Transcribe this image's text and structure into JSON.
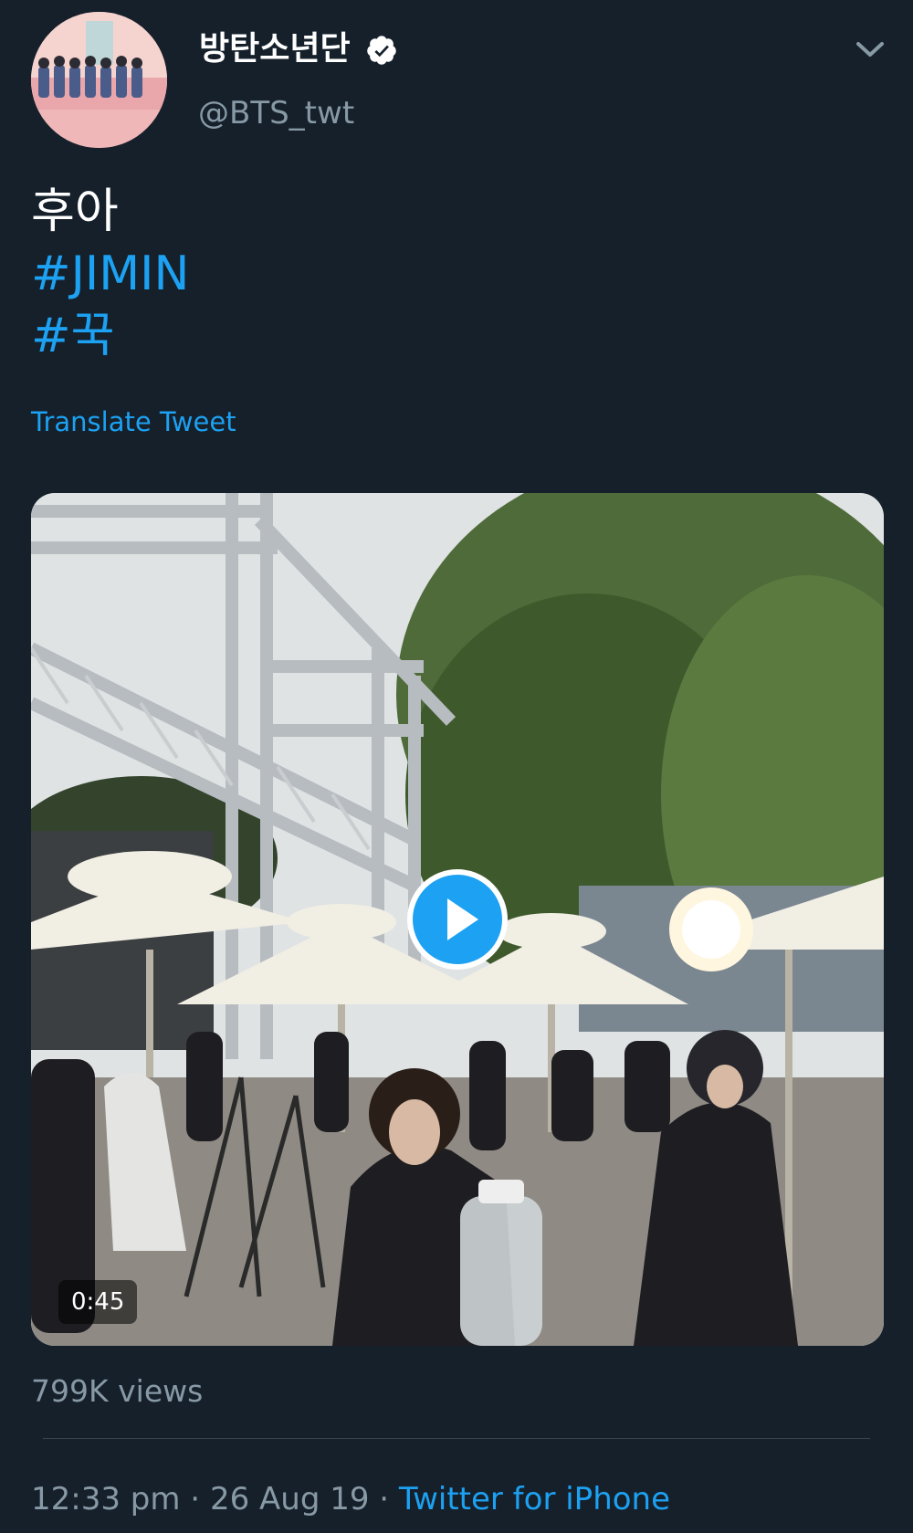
{
  "tweet": {
    "display_name": "방탄소년단",
    "handle": "@BTS_twt",
    "text_line": "후아",
    "hashtags": [
      "#JIMIN",
      "#꾹"
    ],
    "translate_label": "Translate Tweet",
    "video_duration": "0:45",
    "views": "799K views",
    "time": "12:33 pm",
    "separator": " · ",
    "date": "26 Aug 19",
    "source": "Twitter for iPhone"
  },
  "icons": {
    "verified": "verified-badge-icon",
    "menu": "chevron-down-icon",
    "play": "play-icon"
  },
  "colors": {
    "background": "#15202b",
    "link": "#1da1f2",
    "secondary_text": "#8899a6"
  }
}
